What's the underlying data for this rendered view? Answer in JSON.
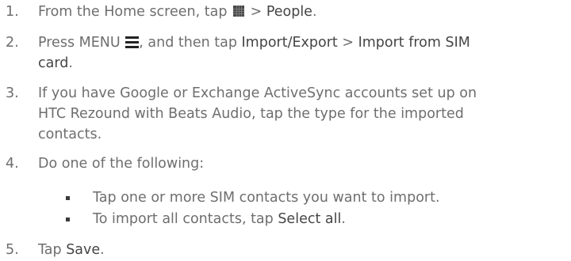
{
  "steps": [
    {
      "num": "1.",
      "parts": [
        "From the Home screen, tap ",
        " > ",
        "People",
        "."
      ]
    },
    {
      "num": "2.",
      "parts": [
        "Press MENU ",
        ", and then tap ",
        "Import/Export",
        " > ",
        "Import from SIM",
        "card",
        "."
      ]
    },
    {
      "num": "3.",
      "lines": [
        "If you have Google or Exchange ActiveSync accounts set up on",
        "HTC Rezound with Beats Audio, tap the type for the imported",
        "contacts."
      ]
    },
    {
      "num": "4.",
      "text": "Do one of the following:",
      "bullets": [
        {
          "parts": [
            "Tap one or more SIM contacts you want to import."
          ]
        },
        {
          "parts": [
            "To import all contacts, tap ",
            "Select all",
            "."
          ]
        }
      ]
    },
    {
      "num": "5.",
      "parts": [
        "Tap ",
        "Save",
        "."
      ]
    }
  ],
  "icons": {
    "apps": "all-apps-icon",
    "menu": "menu-icon"
  }
}
